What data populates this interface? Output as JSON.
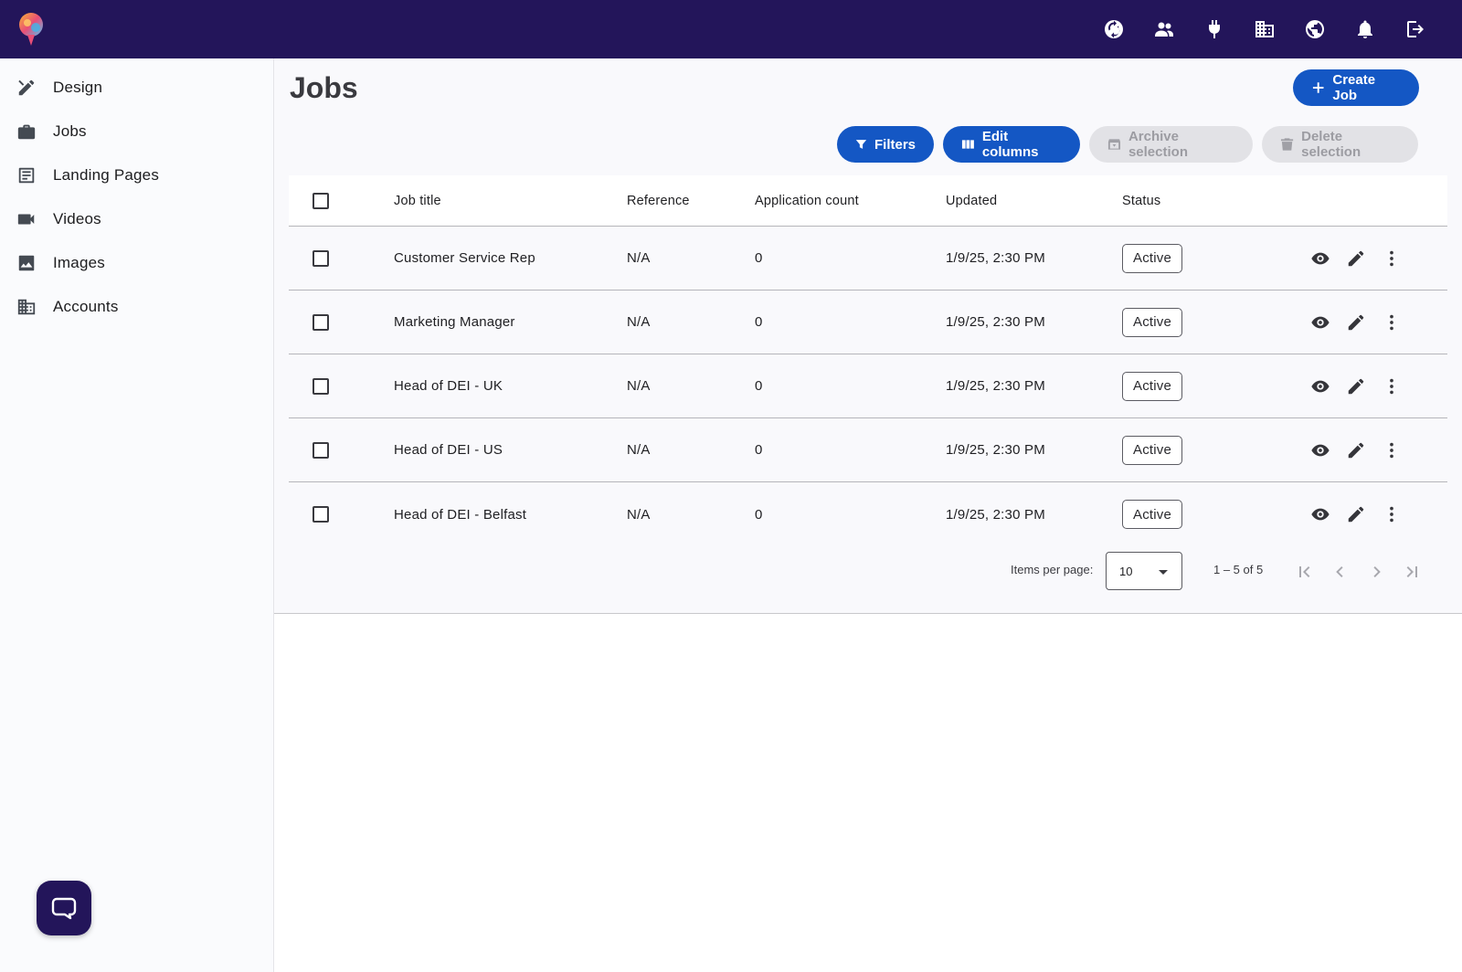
{
  "topbar": {
    "icons": [
      "sync-icon",
      "people-icon",
      "plug-icon",
      "building-icon",
      "globe-icon",
      "bell-icon",
      "logout-icon"
    ]
  },
  "sidebar": {
    "items": [
      {
        "label": "Design",
        "icon": "design-icon"
      },
      {
        "label": "Jobs",
        "icon": "briefcase-icon"
      },
      {
        "label": "Landing Pages",
        "icon": "landing-page-icon"
      },
      {
        "label": "Videos",
        "icon": "video-icon"
      },
      {
        "label": "Images",
        "icon": "image-icon"
      },
      {
        "label": "Accounts",
        "icon": "building-icon"
      }
    ]
  },
  "main": {
    "title": "Jobs",
    "create_label": "Create Job",
    "filters_label": "Filters",
    "edit_columns_label": "Edit columns",
    "archive_label": "Archive selection",
    "delete_label": "Delete selection"
  },
  "table": {
    "columns": [
      "Job title",
      "Reference",
      "Application count",
      "Updated",
      "Status"
    ],
    "rows": [
      {
        "title": "Customer Service Rep",
        "reference": "N/A",
        "count": "0",
        "updated": "1/9/25, 2:30 PM",
        "status": "Active"
      },
      {
        "title": "Marketing Manager",
        "reference": "N/A",
        "count": "0",
        "updated": "1/9/25, 2:30 PM",
        "status": "Active"
      },
      {
        "title": "Head of DEI - UK",
        "reference": "N/A",
        "count": "0",
        "updated": "1/9/25, 2:30 PM",
        "status": "Active"
      },
      {
        "title": "Head of DEI - US",
        "reference": "N/A",
        "count": "0",
        "updated": "1/9/25, 2:30 PM",
        "status": "Active"
      },
      {
        "title": "Head of DEI - Belfast",
        "reference": "N/A",
        "count": "0",
        "updated": "1/9/25, 2:30 PM",
        "status": "Active"
      }
    ]
  },
  "paginator": {
    "items_label": "Items per page:",
    "page_size": "10",
    "range": "1 – 5 of 5"
  },
  "colors": {
    "topbar": "#23155a",
    "primary": "#1457c4",
    "disabled": "#e2e2e6"
  }
}
